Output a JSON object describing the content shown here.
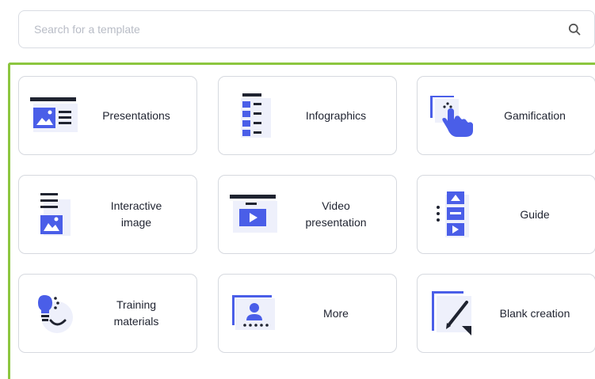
{
  "search": {
    "placeholder": "Search for a template",
    "value": ""
  },
  "colors": {
    "accent": "#4a5ee8",
    "frame": "#8cc63f",
    "dark": "#1f2330"
  },
  "templates": [
    {
      "label": "Presentations",
      "icon": "presentation-icon"
    },
    {
      "label": "Infographics",
      "icon": "infographic-icon"
    },
    {
      "label": "Gamification",
      "icon": "gamification-hand-icon"
    },
    {
      "label": "Interactive\nimage",
      "icon": "interactive-image-icon"
    },
    {
      "label": "Video\npresentation",
      "icon": "video-presentation-icon"
    },
    {
      "label": "Guide",
      "icon": "guide-icon"
    },
    {
      "label": "Training\nmaterials",
      "icon": "training-lightbulb-icon"
    },
    {
      "label": "More",
      "icon": "more-user-icon"
    },
    {
      "label": "Blank creation",
      "icon": "blank-pencil-icon"
    }
  ]
}
